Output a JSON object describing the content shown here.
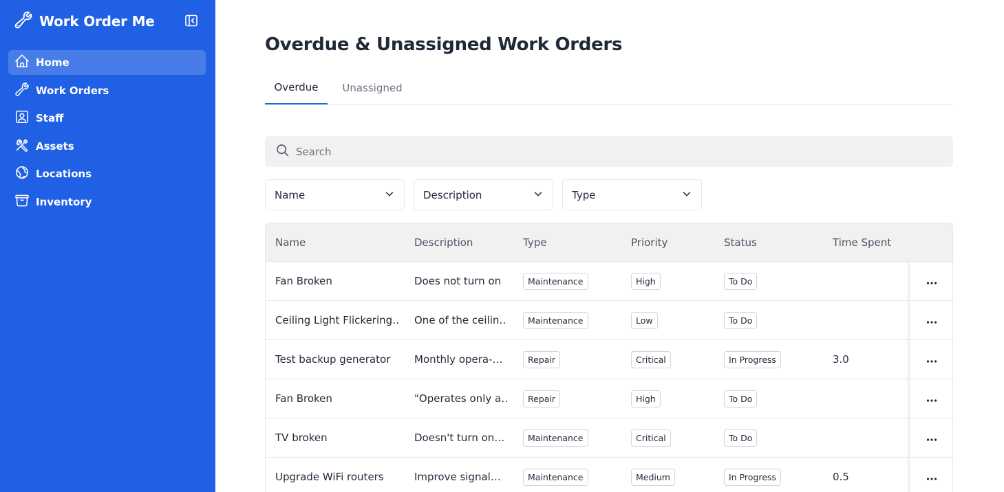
{
  "app": {
    "name": "Work Order Me"
  },
  "sidebar": {
    "items": [
      {
        "label": "Home",
        "icon": "home-icon",
        "active": true
      },
      {
        "label": "Work Orders",
        "icon": "wrench-icon"
      },
      {
        "label": "Staff",
        "icon": "user-badge-icon"
      },
      {
        "label": "Assets",
        "icon": "tools-icon"
      },
      {
        "label": "Locations",
        "icon": "globe-icon"
      },
      {
        "label": "Inventory",
        "icon": "archive-box-icon"
      }
    ]
  },
  "page": {
    "title": "Overdue & Unassigned Work Orders"
  },
  "tabs": [
    {
      "label": "Overdue",
      "active": true
    },
    {
      "label": "Unassigned",
      "active": false
    }
  ],
  "search": {
    "placeholder": "Search",
    "value": ""
  },
  "filters": [
    {
      "label": "Name"
    },
    {
      "label": "Description"
    },
    {
      "label": "Type"
    }
  ],
  "table": {
    "columns": [
      "Name",
      "Description",
      "Type",
      "Priority",
      "Status",
      "Time Spent"
    ],
    "rows": [
      {
        "name": "Fan Broken",
        "description": "Does not turn on",
        "type": "Maintenance",
        "priority": "High",
        "status": "To Do",
        "time_spent": ""
      },
      {
        "name": "Ceiling Light Flickering…",
        "description": "One of the ceilin…",
        "type": "Maintenance",
        "priority": "Low",
        "status": "To Do",
        "time_spent": ""
      },
      {
        "name": "Test backup generator",
        "description": "Monthly opera-…",
        "type": "Repair",
        "priority": "Critical",
        "status": "In Progress",
        "time_spent": "3.0"
      },
      {
        "name": "Fan Broken",
        "description": "\"Operates only a…",
        "type": "Repair",
        "priority": "High",
        "status": "To Do",
        "time_spent": ""
      },
      {
        "name": "TV broken",
        "description": "Doesn't turn on…",
        "type": "Maintenance",
        "priority": "Critical",
        "status": "To Do",
        "time_spent": ""
      },
      {
        "name": "Upgrade WiFi routers",
        "description": "Improve signal…",
        "type": "Maintenance",
        "priority": "Medium",
        "status": "In Progress",
        "time_spent": "0.5"
      }
    ]
  },
  "colors": {
    "sidebar": "#2060e4",
    "accent": "#2563eb"
  }
}
